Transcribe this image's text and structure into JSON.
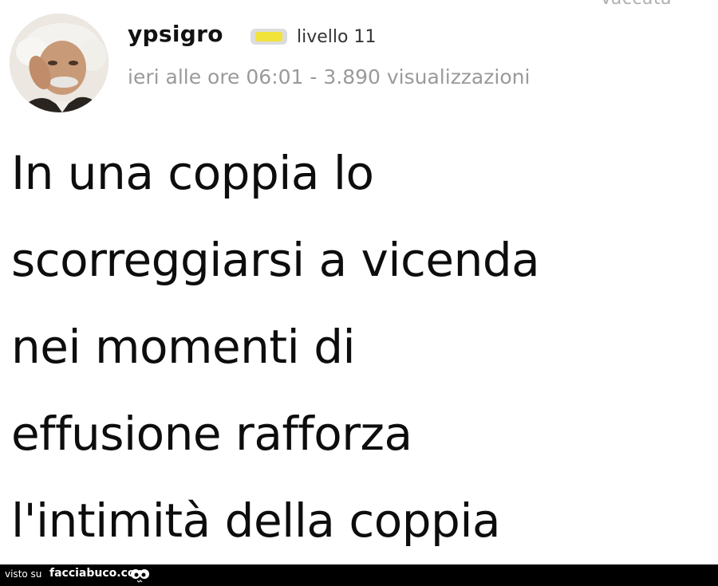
{
  "header": {
    "cut_text": "Vaccata",
    "username": "ypsigro",
    "level_label": "livello 11",
    "meta": "ieri alle ore 06:01 - 3.890 visualizzazioni",
    "badge_color": "#f2e33a"
  },
  "post": {
    "lines": [
      "In una coppia lo",
      "scorreggiarsi a vicenda",
      "nei momenti di",
      "effusione rafforza",
      "l'intimità della coppia"
    ]
  },
  "footer": {
    "visto_su": "visto su",
    "site": "facciabuco.com",
    "logo_icon": "eyes-icon"
  }
}
